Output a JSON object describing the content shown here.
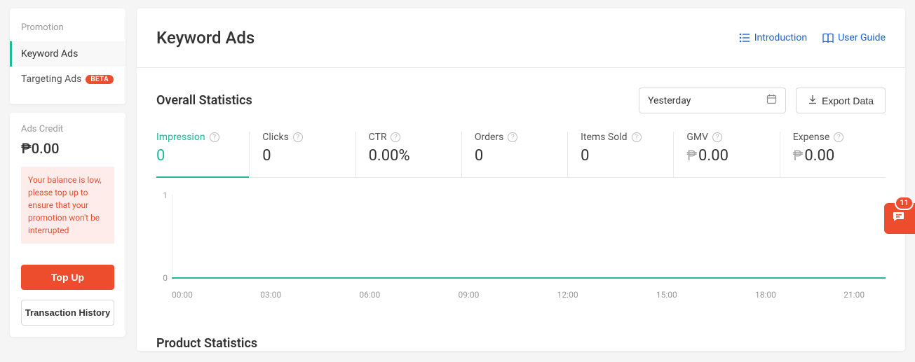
{
  "sidebar": {
    "promotion_label": "Promotion",
    "items": [
      {
        "label": "Keyword Ads",
        "active": true
      },
      {
        "label": "Targeting Ads",
        "active": false,
        "badge": "BETA"
      }
    ]
  },
  "ads_credit": {
    "label": "Ads Credit",
    "amount": "₱0.00",
    "alert": "Your balance is low, please top up to ensure that your promotion won't be interrupted",
    "topup_label": "Top Up",
    "history_label": "Transaction History"
  },
  "header": {
    "title": "Keyword Ads",
    "intro_label": "Introduction",
    "guide_label": "User Guide"
  },
  "overall": {
    "title": "Overall Statistics",
    "date_label": "Yesterday",
    "export_label": "Export Data",
    "metrics": [
      {
        "label": "Impression",
        "value": "0",
        "currency": false
      },
      {
        "label": "Clicks",
        "value": "0",
        "currency": false
      },
      {
        "label": "CTR",
        "value": "0.00%",
        "currency": false
      },
      {
        "label": "Orders",
        "value": "0",
        "currency": false
      },
      {
        "label": "Items Sold",
        "value": "0",
        "currency": false
      },
      {
        "label": "GMV",
        "value": "0.00",
        "currency": true
      },
      {
        "label": "Expense",
        "value": "0.00",
        "currency": true
      }
    ]
  },
  "chart_data": {
    "type": "line",
    "x": [
      "00:00",
      "03:00",
      "06:00",
      "09:00",
      "12:00",
      "15:00",
      "18:00",
      "21:00"
    ],
    "series": [
      {
        "name": "Impression",
        "values": [
          0,
          0,
          0,
          0,
          0,
          0,
          0,
          0
        ]
      }
    ],
    "ylim": [
      0,
      1
    ],
    "yticks": [
      0,
      1
    ],
    "xlabel": "",
    "ylabel": ""
  },
  "product_stats": {
    "title": "Product Statistics"
  },
  "chat": {
    "badge": "11"
  },
  "currency_symbol": "₱"
}
